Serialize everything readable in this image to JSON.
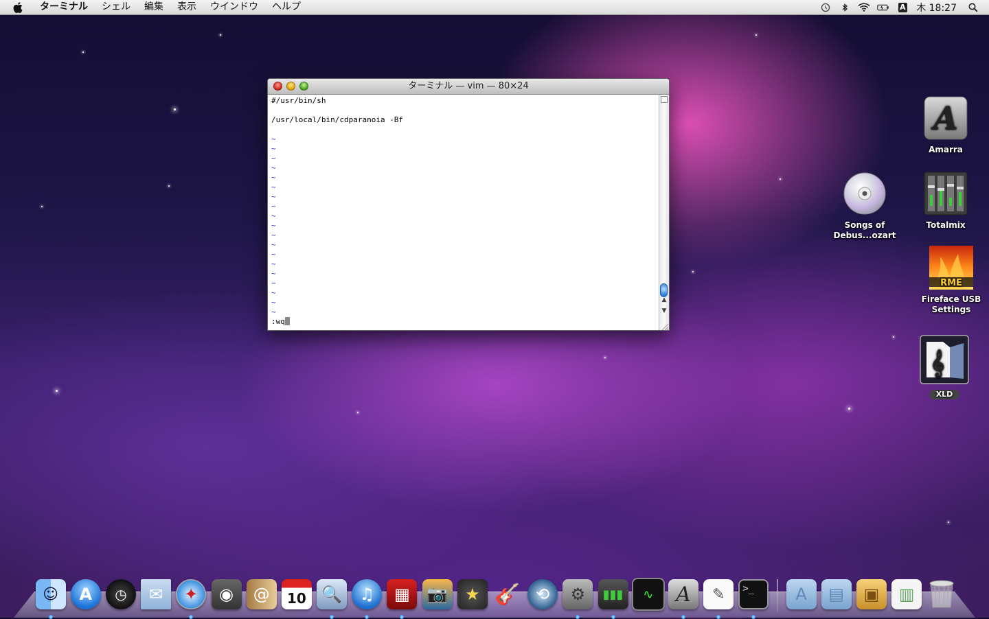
{
  "menubar": {
    "app_name": "ターミナル",
    "menus": [
      "シェル",
      "編集",
      "表示",
      "ウインドウ",
      "ヘルプ"
    ],
    "ime_indicator": "A",
    "clock": "木 18:27",
    "icons": [
      "apple-icon",
      "time-machine-icon",
      "bluetooth-icon",
      "wifi-icon",
      "battery-icon",
      "input-method-icon",
      "spotlight-icon"
    ]
  },
  "terminal": {
    "title": "ターミナル — vim — 80×24",
    "lines": [
      "#/usr/bin/sh",
      "",
      "/usr/local/bin/cdparanoia -Bf",
      ""
    ],
    "tilde": "~",
    "tilde_count": 19,
    "command": ":wq"
  },
  "desktop_icons": {
    "amarra": "Amarra",
    "totalmix": "Totalmix",
    "songs_line1": "Songs of",
    "songs_line2": "Debus...ozart",
    "fireface_line1": "Fireface USB",
    "fireface_line2": "Settings",
    "xld": "XLD"
  },
  "dock": {
    "apps": [
      "Finder",
      "App Store",
      "Dashboard",
      "Mail",
      "Safari",
      "FaceTime",
      "Address Book",
      "iCal",
      "Preview",
      "iTunes",
      "Front Row",
      "iPhoto",
      "iMovie",
      "GarageBand",
      "Time Machine",
      "System Preferences",
      "Totalmix",
      "Activity Monitor",
      "Amarra",
      "TextEdit",
      "Terminal"
    ],
    "calendar_date": "10",
    "folders": [
      "Applications",
      "Documents",
      "Downloads",
      "Preview Doc",
      "Trash"
    ],
    "colors": {
      "running_dot": "#3aa1ff"
    }
  }
}
